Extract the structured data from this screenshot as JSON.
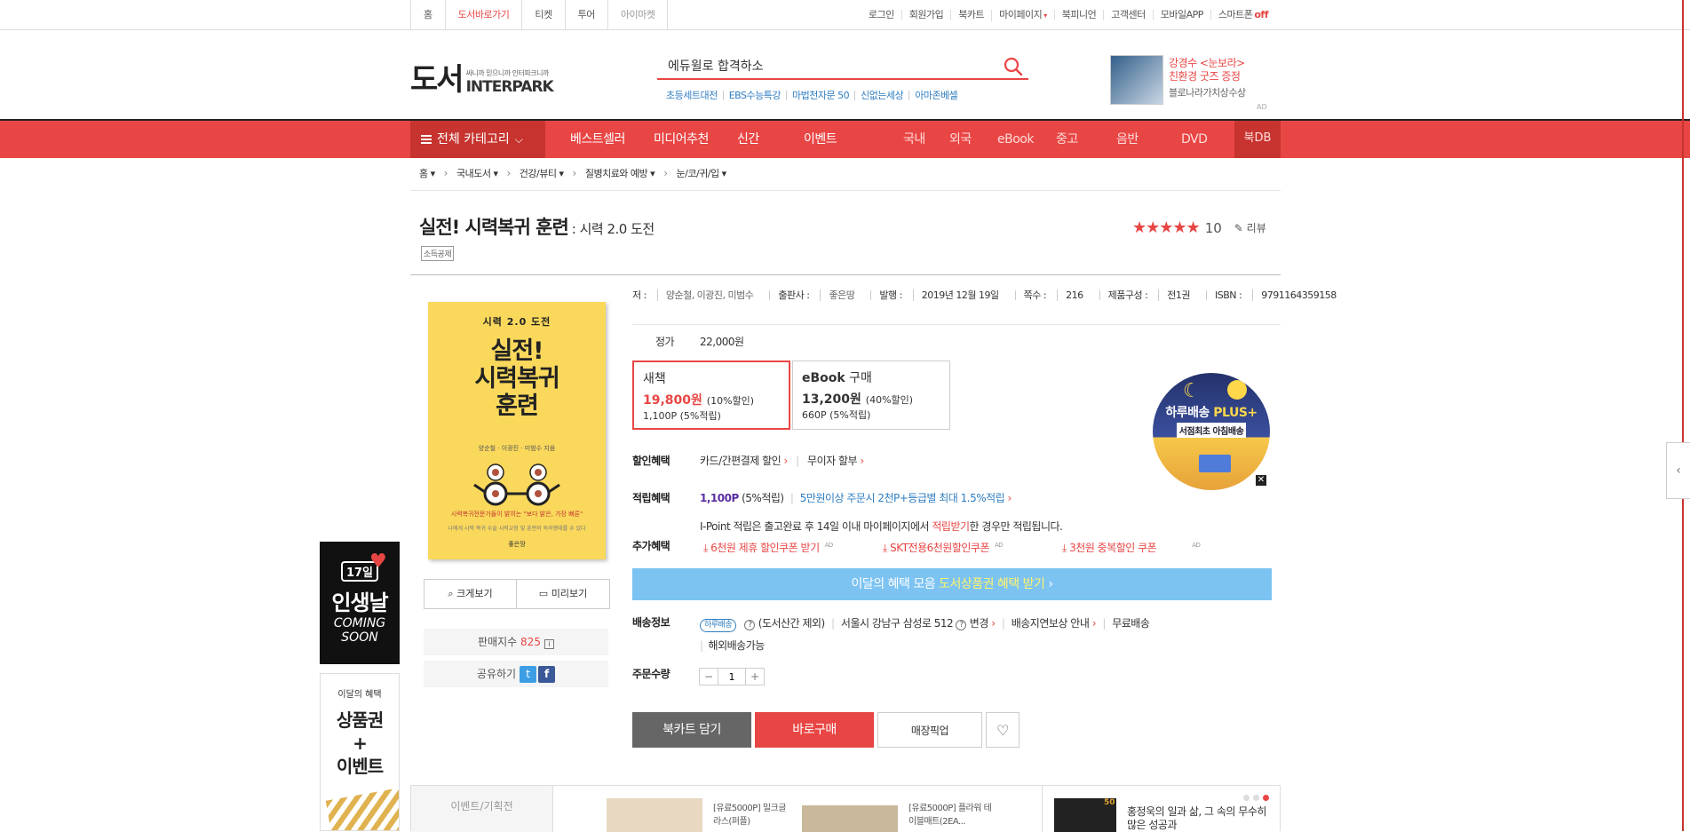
{
  "topbar": {
    "left": [
      "홈",
      "도서바로가기",
      "티켓",
      "투어",
      "아이마켓"
    ],
    "right": [
      "로그인",
      "회원가입",
      "북카트",
      "마이페이지",
      "북피니언",
      "고객센터",
      "모바일APP",
      "스마트폰"
    ],
    "smartphone_state": "off"
  },
  "header": {
    "logo_big": "도서",
    "logo_tag": "싸니까 믿으니까 인터파크니까",
    "logo_brand": "INTERPARK",
    "search_value": "에듀윌로 합격하소",
    "keywords": [
      "초등세트대전",
      "EBS수능특강",
      "마법천자문 50",
      "신없는세상",
      "아마존베셀"
    ],
    "ad_line1": "강경수 <눈보라>",
    "ad_line2": "친환경 굿즈 증정",
    "ad_line3": "블로나라가치상수상",
    "ad_label": "AD"
  },
  "nav": {
    "all_category": "전체 카테고리",
    "main": [
      "베스트셀러",
      "미디어추천",
      "신간",
      "이벤트"
    ],
    "sub": [
      "국내",
      "외국",
      "eBook",
      "중고",
      "음반",
      "DVD"
    ],
    "bookdb": "북DB"
  },
  "breadcrumb": [
    "홈",
    "국내도서",
    "건강/뷰티",
    "질병치료와 예방",
    "눈/코/귀/입"
  ],
  "product": {
    "title": "실전! 시력복귀 훈련",
    "subtitle": ": 시력 2.0 도전",
    "tag": "소득공제",
    "stars": "★★★★★",
    "score": "10",
    "review_label": "리뷰",
    "cover": {
      "top": "시력 2.0 도전",
      "main_line1": "실전!",
      "main_line2": "시력복귀",
      "main_line3": "훈련",
      "authors": "양순철 · 이광진 · 미범수 지음",
      "red": "시력복귀전문가들이 밝히는 \"보다 밝은, 가장 빠른\"",
      "blurb": "나에게 시력 복귀 수술 시력교정 및 훈련의 독의평태를 수 있다",
      "publisher": "좋은땅"
    },
    "btn_zoom": "크게보기",
    "btn_preview": "미리보기",
    "sales_label": "판매지수",
    "sales_value": "825",
    "share_label": "공유하기"
  },
  "meta": [
    {
      "k": "저 : ",
      "v": "양순철, 이광진, 미범수"
    },
    {
      "k": "출판사 : ",
      "v": "좋은땅"
    },
    {
      "k": "발행 : ",
      "v": "2019년 12월 19일"
    },
    {
      "k": "쪽수 : ",
      "v": "216"
    },
    {
      "k": "제품구성 : ",
      "v": "전1권"
    },
    {
      "k": "ISBN : ",
      "v": "9791164359158"
    }
  ],
  "price": {
    "label": "정가",
    "value": "22,000원",
    "new": {
      "title": "새책",
      "price": "19,800원",
      "rate": "(10%할인)",
      "point": "1,100P (5%적립)"
    },
    "ebook": {
      "title": "eBook",
      "title2": "구매",
      "price": "13,200원",
      "rate": "(40%할인)",
      "point": "660P (5%적립)"
    }
  },
  "haru": {
    "line1a": "하루배송",
    "line1b": "PLUS+",
    "line2": "서점최초 아침배송"
  },
  "benefits": {
    "discount_label": "할인혜택",
    "discount_items": [
      "카드/간편결제 할인",
      "무이자 할부"
    ],
    "point_label": "적립혜택",
    "point_value": "1,100P",
    "point_rate": "(5%적립)",
    "point_extra": "5만원이상 주문시 2천P+등급별 최대 1.5%적립",
    "ipoint_a": "I-Point 적립은 출고완료 후 14일 이내 마이페이지에서",
    "ipoint_b": "적립받기",
    "ipoint_c": "한 경우만 적립됩니다.",
    "extra_label": "추가혜택",
    "coupons": [
      "6천원 제휴 할인쿠폰 받기",
      "SKT전용6천원할인쿠폰",
      "3천원 중복할인 쿠폰"
    ],
    "coupon_ad": "AD"
  },
  "monthbar": {
    "a": "이달의 혜택 모음",
    "b": "도서상품권 혜택 받기"
  },
  "delivery": {
    "label": "배송정보",
    "badge": "하루배송",
    "exclude": "(도서산간 제외)",
    "address": "서울시 강남구 삼성로 512",
    "change": "변경",
    "compensation": "배송지연보상 안내",
    "free": "무료배송",
    "overseas": "해외배송가능"
  },
  "order": {
    "label": "주문수량",
    "qty": "1",
    "minus": "−",
    "plus": "+"
  },
  "actions": {
    "cart": "북카트 담기",
    "buy": "바로구매",
    "pickup": "매장픽업",
    "wish": "♡"
  },
  "side": {
    "banner1_date": "17일",
    "banner1_title": "인생날",
    "banner1_sub1": "COMING",
    "banner1_sub2": "SOON",
    "banner2_head": "이달의 혜택",
    "banner2_line1": "상품권",
    "banner2_line2": "+",
    "banner2_line3": "이벤트"
  },
  "bottom": {
    "tab": "이벤트/기획전",
    "p1": "[유료5000P] 밀크글라스(퍼플)",
    "p2": "[유료5000P] 플라워 테이블매트(2EA...",
    "p3_num": "50",
    "p3": "홍정욱의 일과 삶, 그 속의 무수히 많은 성공과"
  }
}
